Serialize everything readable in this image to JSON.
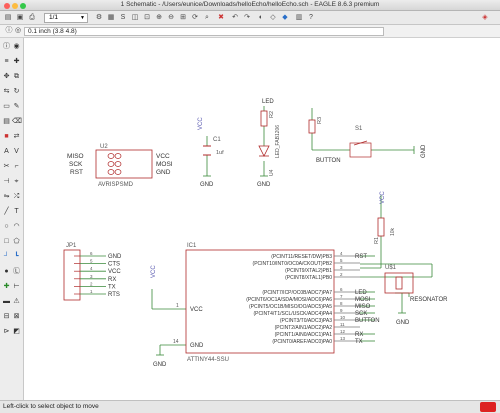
{
  "window": {
    "title": "1 Schematic - /Users/eunice/Downloads/helloEcho/helloEcho.sch - EAGLE 8.6.3 premium"
  },
  "toolbar": {
    "sheet_value": "1/1"
  },
  "params": {
    "grid_readout": "0.1 inch (3.8 4.8)"
  },
  "status": {
    "hint": "Left-click to select object to move"
  },
  "colors": {
    "wire": "#3a8a3a",
    "symbol": "#b02a2a",
    "label": "#5a5ab0",
    "pin": "#7a7a7a"
  },
  "schematic": {
    "u2": {
      "name": "U2",
      "value": "AVRISPSMD",
      "left_pins": [
        "MISO",
        "SCK",
        "RST"
      ],
      "right_pins": [
        "VCC",
        "MOSI",
        "GND"
      ]
    },
    "c1": {
      "net": "VCC",
      "name": "C1",
      "value": "1uf",
      "gnd": "GND"
    },
    "led": {
      "top": "LED",
      "resistor": "R2",
      "diode_name": "LED_FAB1206",
      "diode_ref": "U4",
      "gnd": "GND"
    },
    "button": {
      "resistor": "R3",
      "switch": "S1",
      "label": "BUTTON",
      "gnd": "GND"
    },
    "jp1": {
      "name": "JP1",
      "pin_numbers": [
        "6",
        "5",
        "4",
        "3",
        "2",
        "1"
      ],
      "nets": [
        "GND",
        "CTS",
        "VCC",
        "RX",
        "TX",
        "RTS"
      ]
    },
    "ic1": {
      "name": "IC1",
      "value": "ATTINY44-SSU",
      "vcc_pin": "VCC",
      "gnd_pin": "GND",
      "vcc_pin_no": "1",
      "gnd_pin_no": "14",
      "vcc_net": "VCC",
      "gnd_net": "GND",
      "right_pins": [
        "(PCINT11/RESET/DW)PB3",
        "(PCINT10/INT0/OC0A/CKOUT)PB2",
        "(PCINT9/XTAL2)PB1",
        "(PCINT8/XTAL1)PB0",
        "(PCINT7/ICP/OC0B/ADC7)PA7",
        "(PCINT6/OC1A/SDA/MOSI/ADC6)PA6",
        "(PCINT5/OC1B/MISO/DO/ADC5)PA5",
        "(PCINT4/T1/SCL/USCK/ADC4)PA4",
        "(PCINT3/T0/ADC3)PA3",
        "(PCINT2/AIN1/ADC2)PA2",
        "(PCINT1/AIN0/ADC1)PA1",
        "(PCINT0/AREF/ADC0)PA0"
      ],
      "right_pin_numbers": [
        "4",
        "5",
        "3",
        "2",
        "6",
        "7",
        "8",
        "9",
        "10",
        "11",
        "12",
        "13"
      ],
      "net_labels": [
        "RST",
        "",
        "",
        "",
        "LED",
        "MOSI",
        "MISO",
        "SCK",
        "BUTTON",
        "",
        "RX",
        "TX"
      ]
    },
    "r1": {
      "name": "R1",
      "value": "10k",
      "net": "VCC"
    },
    "resonator": {
      "ref": "U$1",
      "label": "RESONATOR",
      "gnd": "GND"
    }
  }
}
